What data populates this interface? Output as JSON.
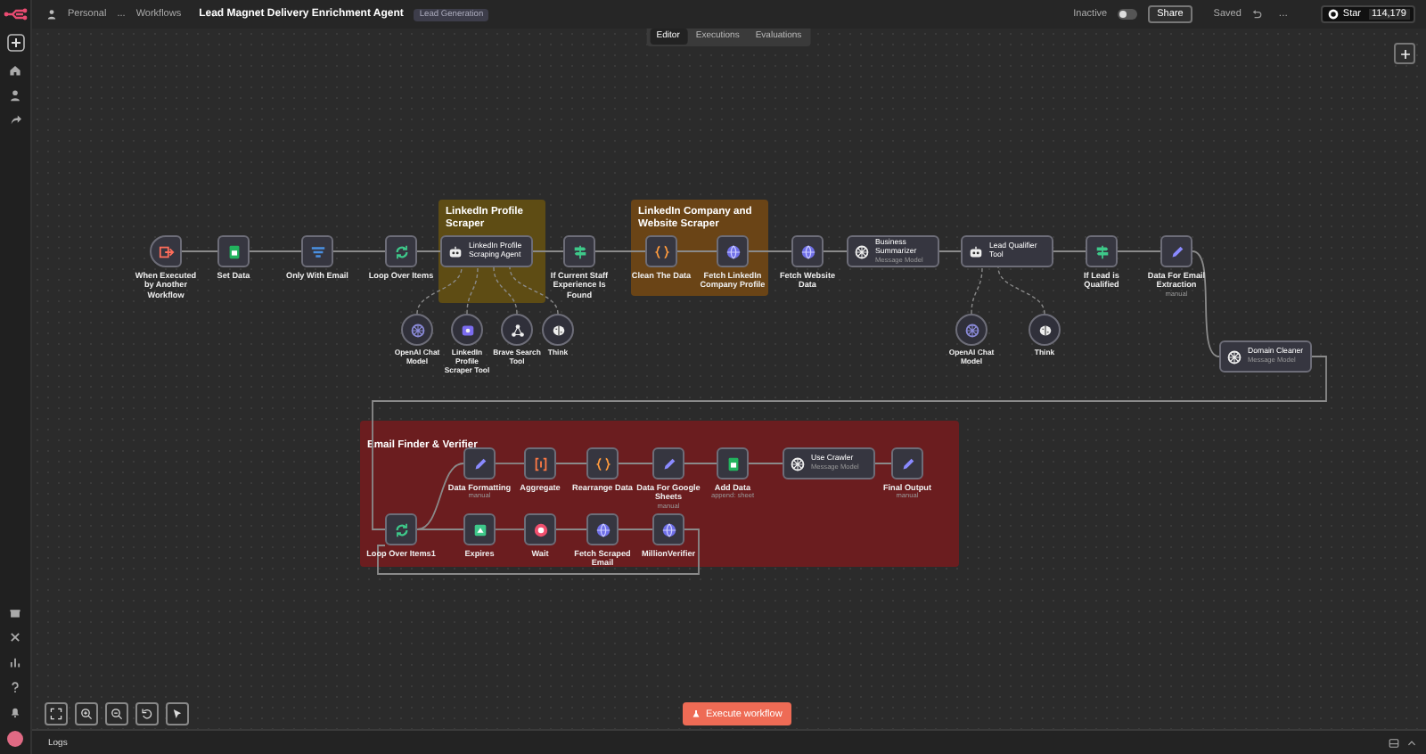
{
  "header": {
    "breadcrumb": [
      "Personal",
      "...",
      "Workflows"
    ],
    "title": "Lead Magnet Delivery Enrichment Agent",
    "tag": "Lead Generation",
    "status": {
      "label": "Inactive",
      "on": false
    },
    "share": "Share",
    "save_state": "Saved",
    "more": "...",
    "github": {
      "label": "Star",
      "count": "114,179"
    }
  },
  "tabs": [
    {
      "label": "Editor",
      "selected": true
    },
    {
      "label": "Executions",
      "selected": false
    },
    {
      "label": "Evaluations",
      "selected": false
    }
  ],
  "stickies": [
    {
      "title": "LinkedIn Profile Scraper",
      "color": "#5e4c14"
    },
    {
      "title": "LinkedIn Company and Website Scraper",
      "color": "#6a4416"
    },
    {
      "title": "Email Finder & Verifier",
      "color": "#6b1d1f"
    }
  ],
  "nodes": [
    {
      "name": "When Executed by Another Workflow",
      "kind": "trigger"
    },
    {
      "name": "Set Data",
      "kind": "sheets"
    },
    {
      "name": "Only With Email",
      "kind": "filter"
    },
    {
      "name": "Loop Over Items",
      "kind": "loop"
    },
    {
      "name": "LinkedIn Profile Scraping Agent",
      "kind": "agent"
    },
    {
      "name": "If Current Staff Experience Is Found",
      "kind": "if"
    },
    {
      "name": "Clean The Data",
      "kind": "code"
    },
    {
      "name": "Fetch LinkedIn Company Profile",
      "kind": "http"
    },
    {
      "name": "Fetch Website Data",
      "kind": "http"
    },
    {
      "name": "Business Summarizer",
      "kind": "llm",
      "subtitle": "Message Model"
    },
    {
      "name": "Lead Qualifier Tool",
      "kind": "agent"
    },
    {
      "name": "If Lead is Qualified",
      "kind": "if"
    },
    {
      "name": "Data For Email Extraction",
      "kind": "set",
      "subtitle": "manual"
    },
    {
      "name": "OpenAI Chat Model",
      "kind": "chat-model"
    },
    {
      "name": "LinkedIn Profile Scraper Tool",
      "kind": "tool"
    },
    {
      "name": "Brave Search Tool",
      "kind": "search-tool"
    },
    {
      "name": "Think",
      "kind": "think"
    },
    {
      "name": "OpenAI Chat Model",
      "kind": "chat-model"
    },
    {
      "name": "Think",
      "kind": "think"
    },
    {
      "name": "Domain Cleaner",
      "kind": "llm",
      "subtitle": "Message Model"
    },
    {
      "name": "Data Formatting",
      "kind": "set",
      "subtitle": "manual"
    },
    {
      "name": "Aggregate",
      "kind": "aggregate"
    },
    {
      "name": "Rearrange Data",
      "kind": "code"
    },
    {
      "name": "Data For Google Sheets",
      "kind": "set",
      "subtitle": "manual"
    },
    {
      "name": "Add Data",
      "kind": "sheets",
      "subtitle": "append: sheet"
    },
    {
      "name": "Use Crawler",
      "kind": "llm",
      "subtitle": "Message Model"
    },
    {
      "name": "Final Output",
      "kind": "set",
      "subtitle": "manual"
    },
    {
      "name": "Loop Over Items1",
      "kind": "loop"
    },
    {
      "name": "Expires",
      "kind": "form"
    },
    {
      "name": "Wait",
      "kind": "stop"
    },
    {
      "name": "Fetch Scraped Email",
      "kind": "http"
    },
    {
      "name": "MillionVerifier",
      "kind": "http"
    }
  ],
  "execute_button": "Execute workflow",
  "logs_panel": {
    "title": "Logs"
  }
}
